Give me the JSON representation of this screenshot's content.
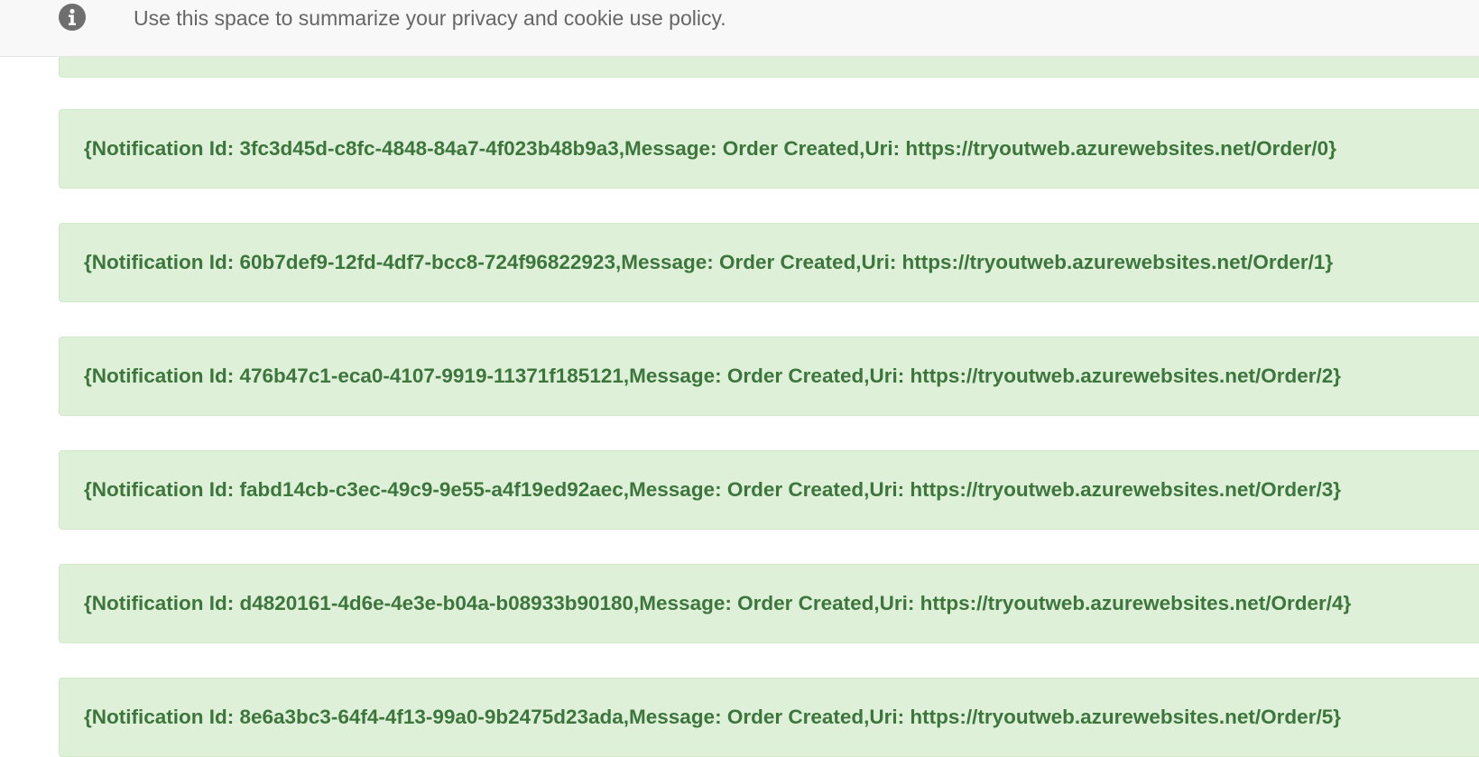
{
  "cookie_banner": {
    "icon": "info-icon",
    "text": "Use this space to summarize your privacy and cookie use policy."
  },
  "notifications": [
    "{Notification Id: 3fc3d45d-c8fc-4848-84a7-4f023b48b9a3,Message: Order Created,Uri: https://tryoutweb.azurewebsites.net/Order/0}",
    "{Notification Id: 60b7def9-12fd-4df7-bcc8-724f96822923,Message: Order Created,Uri: https://tryoutweb.azurewebsites.net/Order/1}",
    "{Notification Id: 476b47c1-eca0-4107-9919-11371f185121,Message: Order Created,Uri: https://tryoutweb.azurewebsites.net/Order/2}",
    "{Notification Id: fabd14cb-c3ec-49c9-9e55-a4f19ed92aec,Message: Order Created,Uri: https://tryoutweb.azurewebsites.net/Order/3}",
    "{Notification Id: d4820161-4d6e-4e3e-b04a-b08933b90180,Message: Order Created,Uri: https://tryoutweb.azurewebsites.net/Order/4}",
    "{Notification Id: 8e6a3bc3-64f4-4f13-99a0-9b2475d23ada,Message: Order Created,Uri: https://tryoutweb.azurewebsites.net/Order/5}"
  ],
  "colors": {
    "alert_bg": "#dff0d8",
    "alert_border": "#d0e9c6",
    "alert_text": "#3c763d",
    "banner_bg": "#f8f8f8"
  }
}
